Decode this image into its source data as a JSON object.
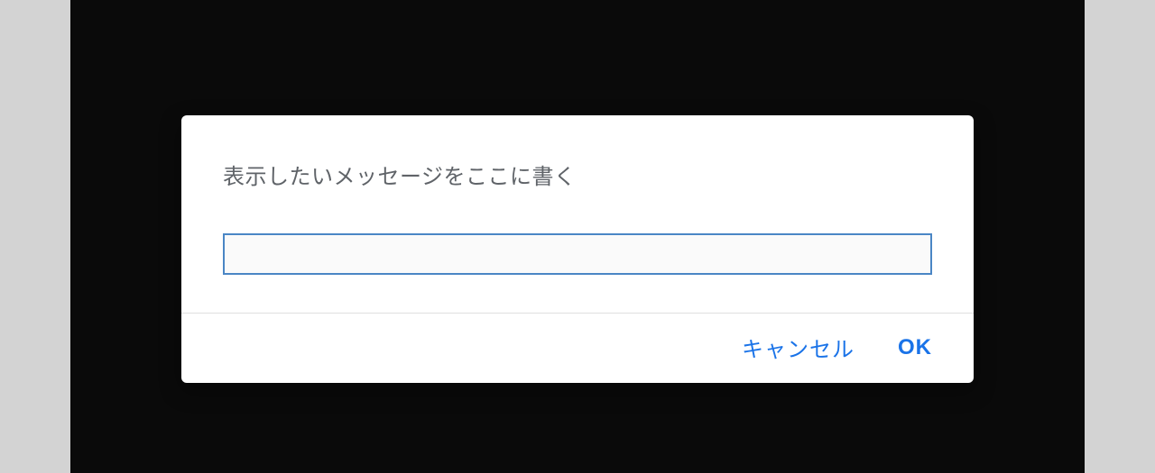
{
  "dialog": {
    "message": "表示したいメッセージをここに書く",
    "input_value": "",
    "cancel_label": "キャンセル",
    "ok_label": "OK"
  }
}
